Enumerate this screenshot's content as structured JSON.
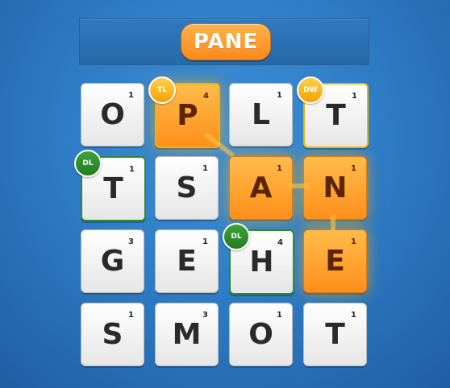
{
  "word_bar": {
    "word": "PANE"
  },
  "board": {
    "tiles": [
      {
        "letter": "O",
        "points": "1",
        "selected": false,
        "bonus": ""
      },
      {
        "letter": "P",
        "points": "4",
        "selected": true,
        "bonus": "TL"
      },
      {
        "letter": "L",
        "points": "1",
        "selected": false,
        "bonus": ""
      },
      {
        "letter": "T",
        "points": "1",
        "selected": false,
        "bonus": "DW"
      },
      {
        "letter": "T",
        "points": "1",
        "selected": false,
        "bonus": "DL"
      },
      {
        "letter": "S",
        "points": "1",
        "selected": false,
        "bonus": ""
      },
      {
        "letter": "A",
        "points": "1",
        "selected": true,
        "bonus": ""
      },
      {
        "letter": "N",
        "points": "1",
        "selected": true,
        "bonus": ""
      },
      {
        "letter": "G",
        "points": "3",
        "selected": false,
        "bonus": ""
      },
      {
        "letter": "E",
        "points": "1",
        "selected": false,
        "bonus": ""
      },
      {
        "letter": "H",
        "points": "4",
        "selected": false,
        "bonus": "DL"
      },
      {
        "letter": "E",
        "points": "1",
        "selected": true,
        "bonus": ""
      },
      {
        "letter": "S",
        "points": "1",
        "selected": false,
        "bonus": ""
      },
      {
        "letter": "M",
        "points": "3",
        "selected": false,
        "bonus": ""
      },
      {
        "letter": "O",
        "points": "1",
        "selected": false,
        "bonus": ""
      },
      {
        "letter": "T",
        "points": "1",
        "selected": false,
        "bonus": ""
      }
    ]
  },
  "colors": {
    "background": "#2f7dc6",
    "tile": "#f2f2f2",
    "tile_selected": "#ff9a22",
    "bonus_dl": "#2e8a2a",
    "bonus_gold": "#f0b400",
    "word_pill": "#ff9a22"
  }
}
